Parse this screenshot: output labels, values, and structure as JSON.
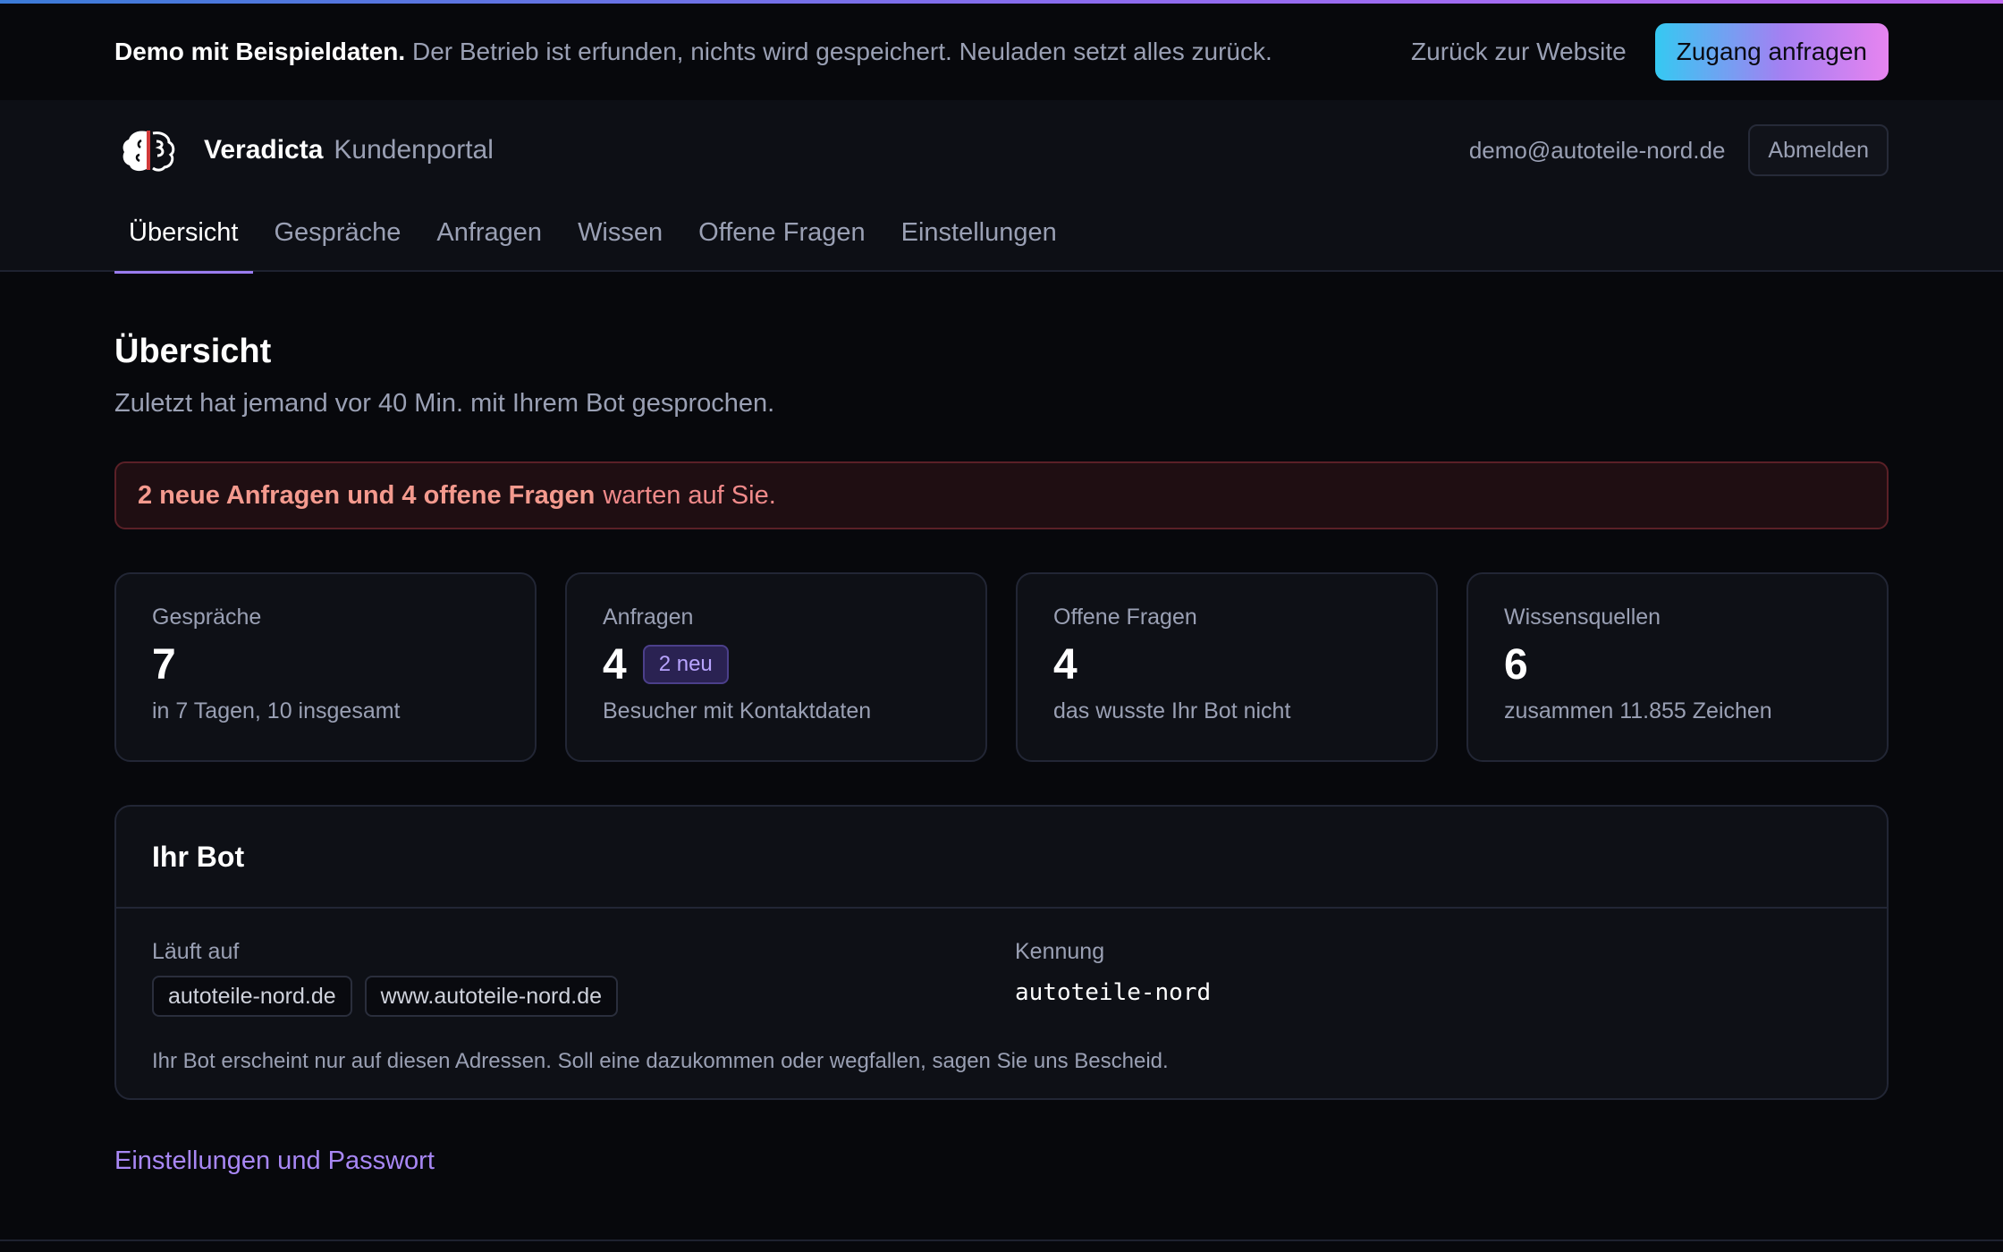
{
  "demo_bar": {
    "bold": "Demo mit Beispieldaten.",
    "text": "Der Betrieb ist erfunden, nichts wird gespeichert. Neuladen setzt alles zurück.",
    "back_link": "Zurück zur Website",
    "cta": "Zugang anfragen"
  },
  "header": {
    "brand": "Veradicta",
    "subtitle": "Kundenportal",
    "user_email": "demo@autoteile-nord.de",
    "logout": "Abmelden"
  },
  "tabs": [
    {
      "label": "Übersicht",
      "active": true
    },
    {
      "label": "Gespräche"
    },
    {
      "label": "Anfragen"
    },
    {
      "label": "Wissen"
    },
    {
      "label": "Offene Fragen"
    },
    {
      "label": "Einstellungen"
    }
  ],
  "page": {
    "title": "Übersicht",
    "subtitle": "Zuletzt hat jemand vor 40 Min. mit Ihrem Bot gesprochen."
  },
  "alert": {
    "bold": "2 neue Anfragen und 4 offene Fragen",
    "text": "warten auf Sie."
  },
  "stats": [
    {
      "label": "Gespräche",
      "value": "7",
      "desc": "in 7 Tagen, 10 insgesamt"
    },
    {
      "label": "Anfragen",
      "value": "4",
      "badge": "2 neu",
      "desc": "Besucher mit Kontaktdaten"
    },
    {
      "label": "Offene Fragen",
      "value": "4",
      "desc": "das wusste Ihr Bot nicht"
    },
    {
      "label": "Wissensquellen",
      "value": "6",
      "desc": "zusammen 11.855 Zeichen"
    }
  ],
  "bot": {
    "title": "Ihr Bot",
    "runs_on_label": "Läuft auf",
    "domains": [
      "autoteile-nord.de",
      "www.autoteile-nord.de"
    ],
    "id_label": "Kennung",
    "id_value": "autoteile-nord",
    "note": "Ihr Bot erscheint nur auf diesen Adressen. Soll eine dazukommen oder wegfallen, sagen Sie uns Bescheid."
  },
  "settings_link": "Einstellungen und Passwort",
  "colors": {
    "background": "#07080c",
    "accent": "#9a7cf0",
    "alert_text": "#f08a8a",
    "link": "#a887f5"
  }
}
